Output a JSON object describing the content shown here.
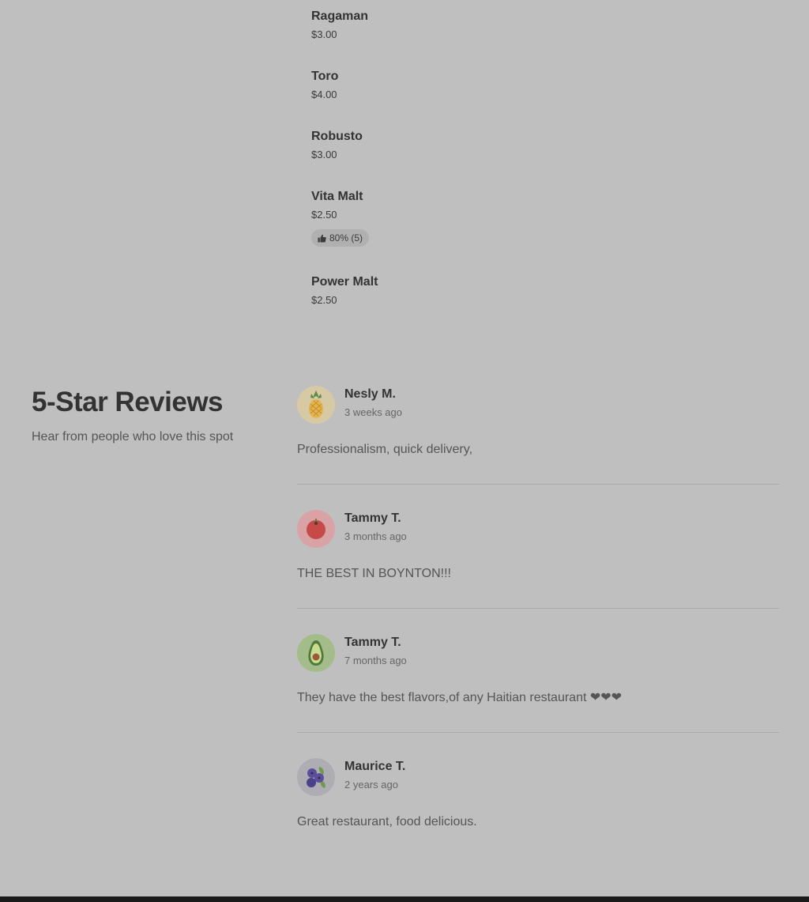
{
  "menu": {
    "items": [
      {
        "name": "Ragaman",
        "price": "$3.00"
      },
      {
        "name": "Toro",
        "price": "$4.00"
      },
      {
        "name": "Robusto",
        "price": "$3.00"
      },
      {
        "name": "Vita Malt",
        "price": "$2.50",
        "rating": "80% (5)"
      },
      {
        "name": "Power Malt",
        "price": "$2.50"
      }
    ]
  },
  "reviews_section": {
    "title": "5-Star Reviews",
    "subtitle": "Hear from people who love this spot",
    "reviews": [
      {
        "name": "Nesly M.",
        "date": "3 weeks ago",
        "text": "Professionalism, quick delivery,",
        "avatar_icon": "pineapple-icon",
        "avatar_bg": "#d6c9a3"
      },
      {
        "name": "Tammy T.",
        "date": "3 months ago",
        "text": "THE BEST IN BOYNTON!!!",
        "avatar_icon": "tomato-icon",
        "avatar_bg": "#d9a3a6"
      },
      {
        "name": "Tammy T.",
        "date": "7 months ago",
        "text": "They have the best flavors,of any Haitian restaurant ❤❤❤",
        "avatar_icon": "avocado-icon",
        "avatar_bg": "#a4bb8a"
      },
      {
        "name": "Maurice T.",
        "date": "2 years ago",
        "text": "Great restaurant, food delicious.",
        "avatar_icon": "blueberry-icon",
        "avatar_bg": "#aeadb3"
      }
    ]
  },
  "colors": {
    "background": "#bfbfbf",
    "text_primary": "#333333",
    "text_secondary": "#555555",
    "badge_bg": "#b0b0b0",
    "divider": "#a9a9a9",
    "bottom_bar": "#1a1a1a"
  }
}
